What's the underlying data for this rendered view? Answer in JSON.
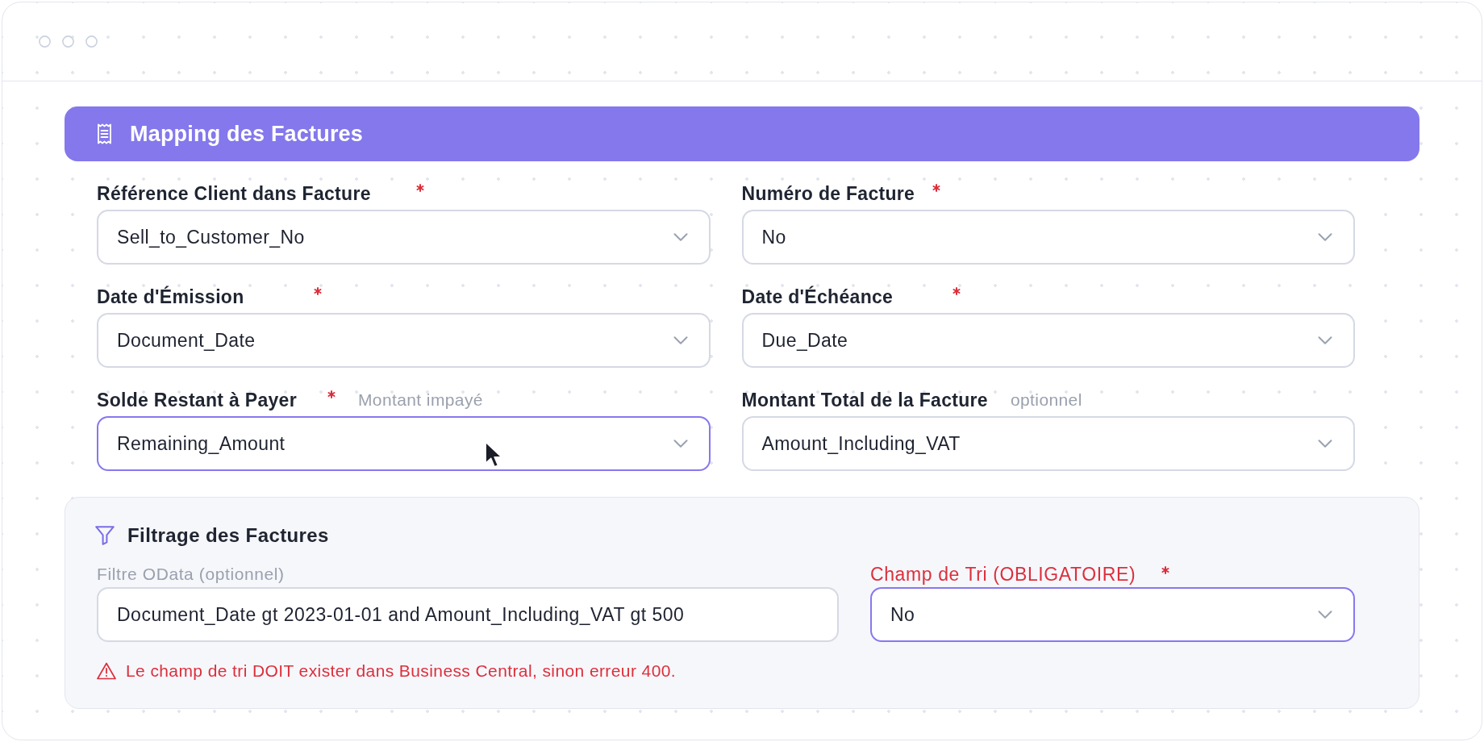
{
  "mapping": {
    "title": "Mapping des Factures",
    "fields": [
      {
        "label": "Référence Client dans Facture",
        "required": true,
        "value": "Sell_to_Customer_No",
        "focused": false,
        "hovered": false
      },
      {
        "label": "Numéro de Facture",
        "required": true,
        "value": "No",
        "focused": false,
        "hovered": false
      },
      {
        "label": "Date d'Émission",
        "required": true,
        "value": "Document_Date",
        "focused": false,
        "hovered": false
      },
      {
        "label": "Date d'Échéance",
        "required": true,
        "value": "Due_Date",
        "focused": false,
        "hovered": false
      },
      {
        "label": "Solde Restant à Payer",
        "required": true,
        "hint": "Montant impayé",
        "value": "Remaining_Amount",
        "focused": true,
        "hovered": true
      },
      {
        "label": "Montant Total de la Facture",
        "required": false,
        "hint": "optionnel",
        "value": "Amount_Including_VAT",
        "focused": false,
        "hovered": false
      }
    ]
  },
  "filtering": {
    "title": "Filtrage des Factures",
    "odata_filter": {
      "label": "Filtre OData (optionnel)",
      "value": "Document_Date gt 2023-01-01 and Amount_Including_VAT gt 500",
      "focused": false
    },
    "sort_field": {
      "label": "Champ de Tri (OBLIGATOIRE)",
      "required": true,
      "value": "No",
      "focused": true
    },
    "warning": "Le champ de tri DOIT exister dans Business Central, sinon erreur 400."
  }
}
